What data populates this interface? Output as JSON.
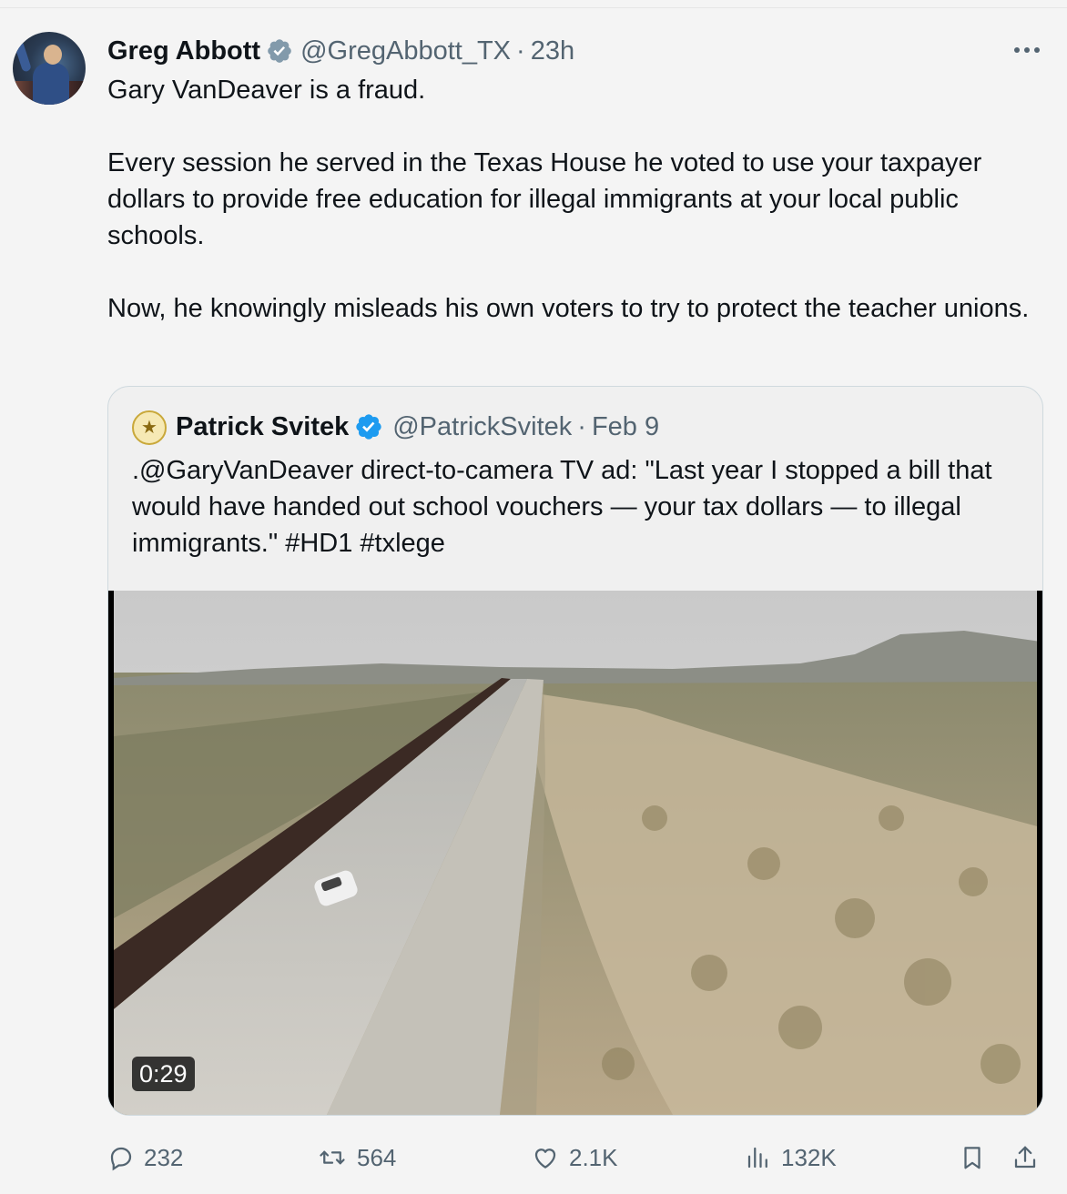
{
  "tweet": {
    "author_name": "Greg Abbott",
    "handle": "@GregAbbott_TX",
    "separator": "·",
    "time": "23h",
    "paragraphs": [
      "Gary VanDeaver is a fraud.",
      "Every session he served in the Texas House he voted to use your taxpayer dollars to provide free education for illegal immigrants at your local public schools.",
      "Now, he knowingly misleads his own voters to try to protect the teacher unions."
    ]
  },
  "quoted": {
    "author_name": "Patrick Svitek",
    "handle": "@PatrickSvitek",
    "separator": "·",
    "time": "Feb 9",
    "text": ".@GaryVanDeaver direct-to-camera TV ad: \"Last year I stopped a bill that would have handed out school vouchers — your tax dollars — to illegal immigrants.\" #HD1 #txlege",
    "video_duration": "0:29"
  },
  "actions": {
    "reply_count": "232",
    "retweet_count": "564",
    "like_count": "2.1K",
    "view_count": "132K"
  },
  "icons": {
    "verified": "verified-badge-icon",
    "more": "more-icon",
    "reply": "reply-icon",
    "retweet": "retweet-icon",
    "like": "heart-icon",
    "views": "views-icon",
    "bookmark": "bookmark-icon",
    "share": "share-icon"
  },
  "colors": {
    "verified_blue": "#1d9bf0",
    "verified_gray": "#829aab",
    "secondary_text": "#536471"
  }
}
